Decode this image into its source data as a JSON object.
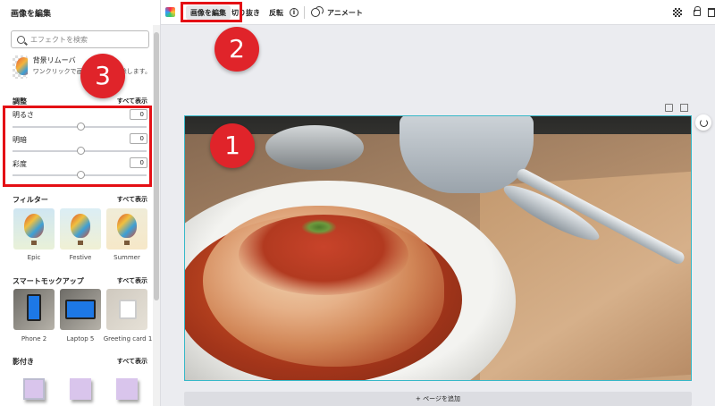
{
  "sidebar": {
    "title": "画像を編集",
    "search_placeholder": "エフェクトを検索",
    "bg_remover": {
      "title": "背景リムーバ",
      "desc": "ワンクリックで画像の背景を削除します。"
    },
    "adjust": {
      "title": "調整",
      "show_all": "すべて表示",
      "sliders": [
        {
          "label": "明るさ",
          "value": "0"
        },
        {
          "label": "明暗",
          "value": "0"
        },
        {
          "label": "彩度",
          "value": "0"
        }
      ]
    },
    "filters": {
      "title": "フィルター",
      "show_all": "すべて表示",
      "items": [
        "Epic",
        "Festive",
        "Summer"
      ]
    },
    "smart_mockups": {
      "title": "スマートモックアップ",
      "show_all": "すべて表示",
      "items": [
        "Phone 2",
        "Laptop 5",
        "Greeting card 1"
      ]
    },
    "shadows": {
      "title": "影付き",
      "show_all": "すべて表示"
    }
  },
  "toolbar": {
    "edit_image": "画像を編集",
    "crop": "切り抜き",
    "flip": "反転",
    "info": "i",
    "animate": "アニメート"
  },
  "canvas": {
    "add_page": "+ ページを追加"
  },
  "steps": [
    "1",
    "2",
    "3"
  ],
  "colors": {
    "highlight": "#e40f15",
    "step_badge": "#e0242a",
    "selection": "#36b8c8"
  }
}
